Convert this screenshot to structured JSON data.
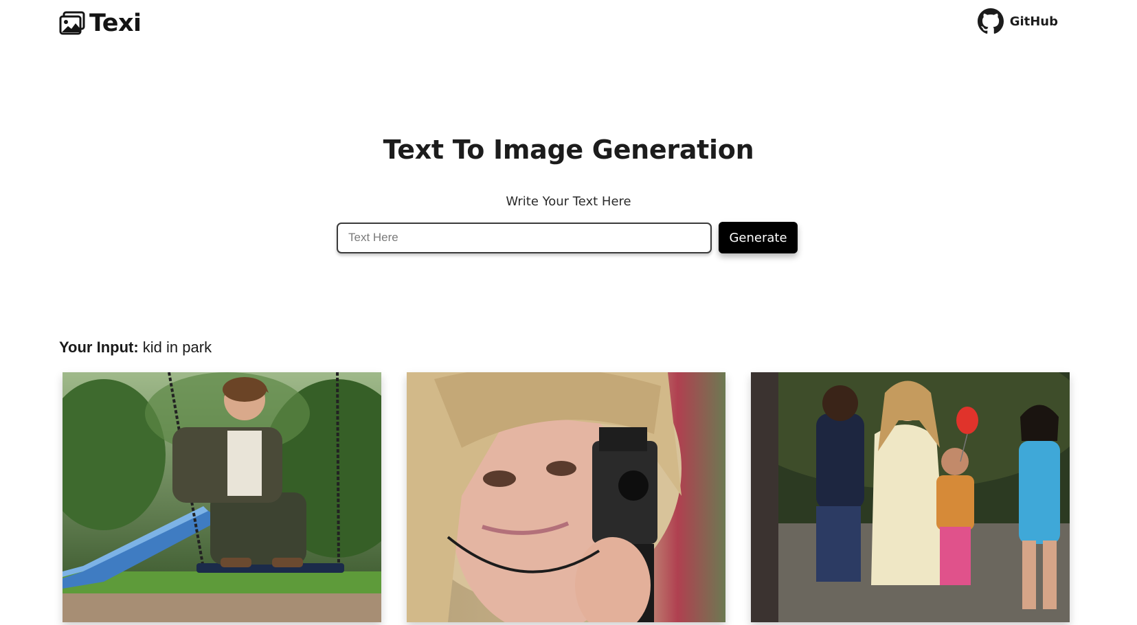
{
  "header": {
    "brand_name": "Texi",
    "brand_icon": "image-gallery-icon",
    "github_label": "GitHub",
    "github_icon": "github-icon"
  },
  "hero": {
    "title": "Text To Image Generation",
    "subtitle": "Write Your Text Here",
    "input_placeholder": "Text Here",
    "input_value": "",
    "generate_label": "Generate"
  },
  "results": {
    "input_label": "Your Input:",
    "input_text": "kid in park",
    "images": [
      {
        "name": "generated-image-1"
      },
      {
        "name": "generated-image-2"
      },
      {
        "name": "generated-image-3"
      }
    ]
  },
  "colors": {
    "text": "#1c1c1c",
    "button_bg": "#000000",
    "button_text": "#ffffff",
    "page_bg": "#ffffff"
  }
}
